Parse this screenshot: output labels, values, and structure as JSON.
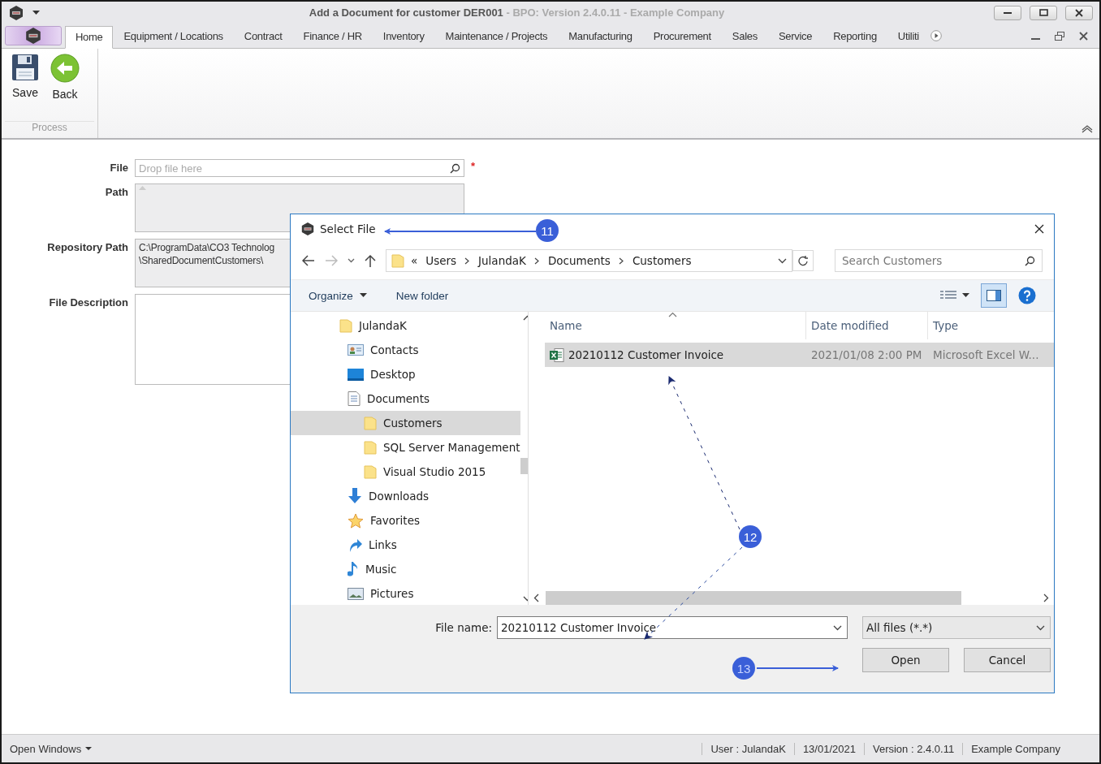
{
  "window": {
    "title": "Add a Document for customer DER001",
    "subtitle": " - BPO: Version 2.4.0.11 - Example Company"
  },
  "ribbon": {
    "tabs": [
      {
        "label": "Home",
        "selected": true
      },
      {
        "label": "Equipment / Locations",
        "selected": false
      },
      {
        "label": "Contract",
        "selected": false
      },
      {
        "label": "Finance / HR",
        "selected": false
      },
      {
        "label": "Inventory",
        "selected": false
      },
      {
        "label": "Maintenance / Projects",
        "selected": false
      },
      {
        "label": "Manufacturing",
        "selected": false
      },
      {
        "label": "Procurement",
        "selected": false
      },
      {
        "label": "Sales",
        "selected": false
      },
      {
        "label": "Service",
        "selected": false
      },
      {
        "label": "Reporting",
        "selected": false
      },
      {
        "label": "Utiliti",
        "selected": false
      }
    ],
    "buttons": [
      {
        "label": "Save",
        "kind": "save"
      },
      {
        "label": "Back",
        "kind": "back"
      }
    ],
    "group": "Process"
  },
  "form": {
    "fields": [
      {
        "label": "File",
        "kind": "search",
        "placeholder": "Drop file here",
        "required": true,
        "required_mark": "*"
      },
      {
        "label": "Path",
        "kind": "memo",
        "disabled": true
      },
      {
        "label": "Repository Path",
        "kind": "memo",
        "lines": [
          "C:\\ProgramData\\CO3 Technolog",
          "\\SharedDocumentCustomers\\"
        ],
        "disabled": true
      },
      {
        "label": "File Description",
        "kind": "memo",
        "disabled": false
      }
    ]
  },
  "dialog": {
    "title": "Select File",
    "address": {
      "overflow": "«",
      "crumbs": [
        "Users",
        "JulandaK",
        "Documents",
        "Customers"
      ]
    },
    "search": {
      "placeholder": "Search Customers"
    },
    "commands": [
      {
        "label": "Organize",
        "dropdown": true
      },
      {
        "label": "New folder",
        "dropdown": false
      }
    ],
    "tree": [
      {
        "label": "JulandaK",
        "kind": "folder",
        "selected": false,
        "children": [
          {
            "label": "Contacts",
            "kind": "contacts",
            "selected": false
          },
          {
            "label": "Desktop",
            "kind": "desktop",
            "selected": false
          },
          {
            "label": "Documents",
            "kind": "documents",
            "selected": false,
            "children": [
              {
                "label": "Customers",
                "kind": "folder",
                "selected": true
              },
              {
                "label": "SQL Server Management",
                "kind": "folder",
                "selected": false
              },
              {
                "label": "Visual Studio 2015",
                "kind": "folder",
                "selected": false
              }
            ]
          },
          {
            "label": "Downloads",
            "kind": "downloads",
            "selected": false
          },
          {
            "label": "Favorites",
            "kind": "favorites",
            "selected": false
          },
          {
            "label": "Links",
            "kind": "links",
            "selected": false
          },
          {
            "label": "Music",
            "kind": "music",
            "selected": false
          },
          {
            "label": "Pictures",
            "kind": "pictures",
            "selected": false
          }
        ]
      }
    ],
    "columns": [
      "Name",
      "Date modified",
      "Type"
    ],
    "files": [
      {
        "name": "20210112 Customer Invoice",
        "date": "2021/01/08 2:00 PM",
        "type": "Microsoft Excel W...",
        "selected": true
      }
    ],
    "file_name_label": "File name:",
    "file_name": "20210112 Customer Invoice",
    "filter": "All files (*.*)",
    "buttons": [
      "Open",
      "Cancel"
    ]
  },
  "annotations": [
    {
      "label": "11"
    },
    {
      "label": "12"
    },
    {
      "label": "13"
    }
  ],
  "status_bar": {
    "open_windows": "Open Windows",
    "items": [
      "User : JulandaK",
      "13/01/2021",
      "Version : 2.4.0.11",
      "Example Company"
    ]
  }
}
